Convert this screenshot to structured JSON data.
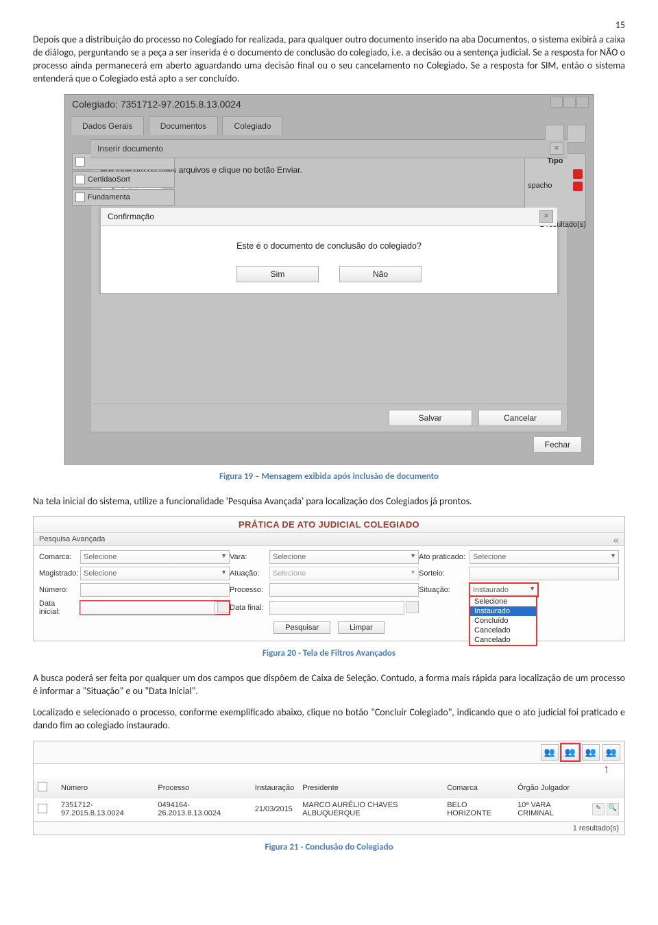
{
  "page_number": "15",
  "para1": "Depois que a distribuição do processo no Colegiado for realizada, para qualquer outro documento inserido na aba Documentos, o sistema exibirá a caixa de diálogo, perguntando se a peça a ser inserida é o documento de conclusão do colegiado, i.e. a decisão ou a sentença judicial. Se a resposta for NÃO o processo ainda permanecerá em aberto aguardando uma decisão final ou o seu cancelamento no Colegiado. Se a resposta for SIM, então o sistema entenderá que o Colegiado está apto a ser concluído.",
  "fig19": {
    "bg_title": "Colegiado: 7351712-97.2015.8.13.0024",
    "tabs": [
      "Dados Gerais",
      "Documentos",
      "Colegiado"
    ],
    "inserir_title": "Inserir documento",
    "inserir_hint": "Adicione um ou mais arquivos e clique no botão Enviar.",
    "add_btn": "Adicionar",
    "confirm_title": "Confirmação",
    "confirm_q": "Este é o documento de conclusão do colegiado?",
    "sim": "Sim",
    "nao": "Não",
    "salvar": "Salvar",
    "cancelar": "Cancelar",
    "tipo": "Tipo",
    "row1": "CertidaoSort",
    "row2": "Fundamenta",
    "spacho": "spacho",
    "results": "2 resultado(s)",
    "fechar": "Fechar",
    "caption": "Figura 19 – Mensagem exibida após inclusão de documento"
  },
  "para2": "Na tela inicial do sistema, utilize a funcionalidade 'Pesquisa Avançada' para localização dos Colegiados já prontos.",
  "fig20": {
    "header": "PRÁTICA DE ATO JUDICIAL COLEGIADO",
    "sub": "Pesquisa Avançada",
    "labels": {
      "comarca": "Comarca:",
      "vara": "Vara:",
      "ato": "Ato praticado:",
      "magistrado": "Magistrado:",
      "atuacao": "Atuação:",
      "sorteio": "Sorteio:",
      "numero": "Número:",
      "processo": "Processo:",
      "situacao": "Situação:",
      "datai": "Data inicial:",
      "dataf": "Data final:"
    },
    "selecione": "Selecione",
    "situacao_val": "Instaurado",
    "drop": [
      "Selecione",
      "Instaurado",
      "Concluído",
      "Cancelado",
      "Cancelado"
    ],
    "pesquisar": "Pesquisar",
    "limpar": "Limpar",
    "caption": "Figura 20 - Tela de Filtros Avançados"
  },
  "para3": "A busca poderá ser feita por qualquer um dos campos que dispõem de Caixa de Seleção. Contudo, a forma mais rápida para localização de um processo é informar a \"Situação\" e ou \"Data Inicial\".",
  "para4": "Localizado e selecionado o processo, conforme exemplificado abaixo, clique no botão \"Concluir Colegiado\", indicando que o ato judicial foi praticado e dando fim ao colegiado instaurado.",
  "fig21": {
    "cols": [
      "",
      "Número",
      "Processo",
      "Instauração",
      "Presidente",
      "Comarca",
      "Órgão Julgador",
      ""
    ],
    "row": [
      "",
      "7351712-97.2015.8.13.0024",
      "0494164-26.2013.8.13.0024",
      "21/03/2015",
      "MARCO AURÉLIO CHAVES ALBUQUERQUE",
      "BELO HORIZONTE",
      "10ª VARA CRIMINAL",
      ""
    ],
    "foot": "1 resultado(s)",
    "caption": "Figura 21 - Conclusão do Colegiado"
  }
}
